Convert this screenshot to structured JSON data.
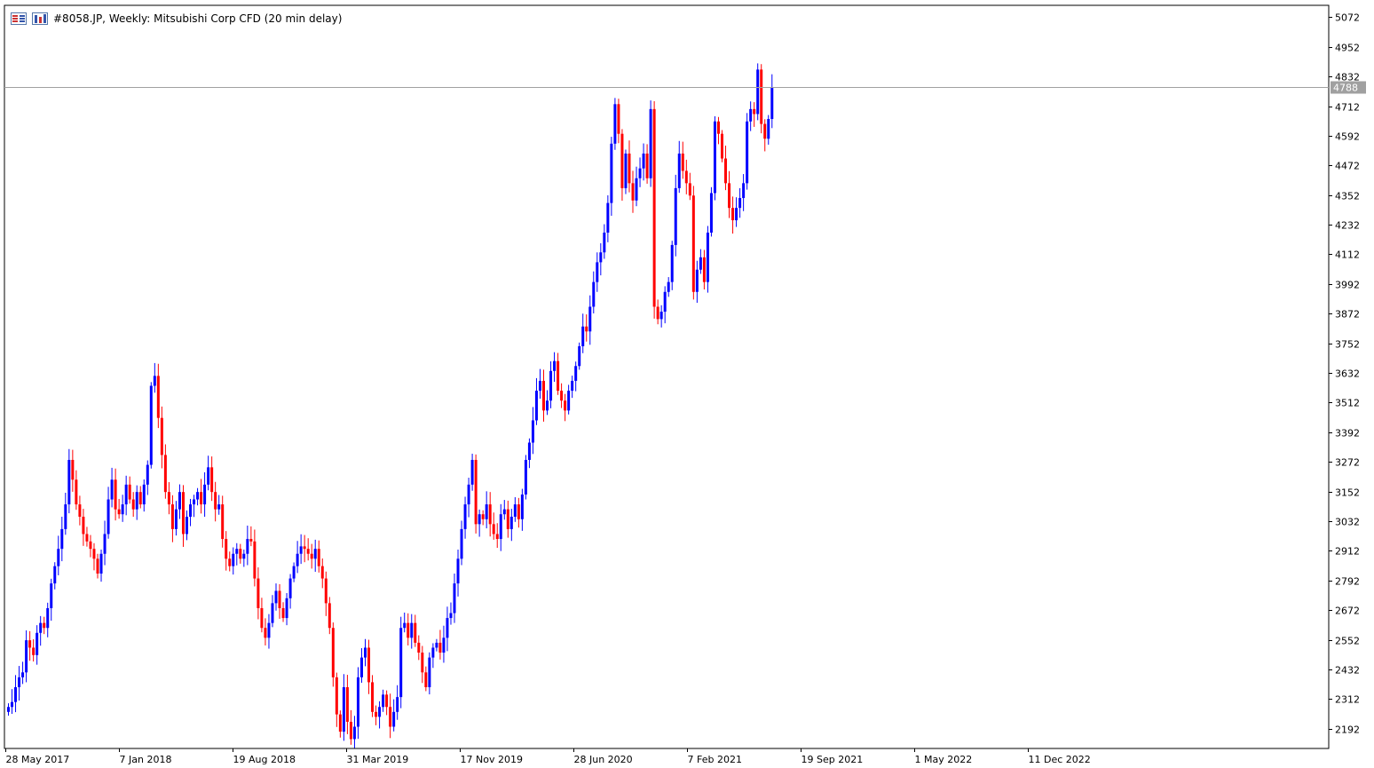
{
  "header": {
    "title": "#8058.JP, Weekly:  Mitsubishi Corp CFD (20 min delay)",
    "icons": [
      "list-icon",
      "depth-of-market-icon"
    ]
  },
  "colors": {
    "up": "#0000ff",
    "down": "#ff0000",
    "grid": "#d8d8d8",
    "axis": "#000000",
    "price_line": "#a0a0a0",
    "price_label_bg": "#a0a0a0"
  },
  "chart_data": {
    "type": "candlestick",
    "title": "#8058.JP, Weekly:  Mitsubishi Corp CFD (20 min delay)",
    "grid": false,
    "y_axis": {
      "ylim": [
        2112,
        5120
      ],
      "ticks": [
        "5072",
        "4952",
        "4832",
        "4712",
        "4592",
        "4472",
        "4352",
        "4232",
        "4112",
        "3992",
        "3872",
        "3752",
        "3632",
        "3512",
        "3392",
        "3272",
        "3152",
        "3032",
        "2912",
        "2792",
        "2672",
        "2552",
        "2432",
        "2312",
        "2192"
      ]
    },
    "x_axis": {
      "ticks": [
        "28 May 2017",
        "7 Jan 2018",
        "19 Aug 2018",
        "31 Mar 2019",
        "17 Nov 2019",
        "28 Jun 2020",
        "7 Feb 2021",
        "19 Sep 2021",
        "1 May 2022",
        "11 Dec 2022"
      ]
    },
    "current_price": "4788",
    "closes": [
      2280,
      2300,
      2360,
      2400,
      2420,
      2550,
      2520,
      2490,
      2580,
      2620,
      2600,
      2680,
      2780,
      2850,
      2920,
      3000,
      3100,
      3280,
      3200,
      3100,
      3050,
      2980,
      2950,
      2920,
      2880,
      2820,
      2900,
      2980,
      3120,
      3200,
      3080,
      3060,
      3100,
      3180,
      3120,
      3080,
      3150,
      3100,
      3180,
      3260,
      3580,
      3620,
      3450,
      3300,
      3150,
      3100,
      3000,
      3080,
      3150,
      2980,
      3050,
      3100,
      3120,
      3150,
      3100,
      3180,
      3250,
      3150,
      3080,
      3100,
      2960,
      2880,
      2850,
      2900,
      2920,
      2880,
      2900,
      2960,
      2950,
      2800,
      2680,
      2600,
      2560,
      2620,
      2700,
      2750,
      2680,
      2640,
      2720,
      2800,
      2850,
      2900,
      2930,
      2920,
      2900,
      2880,
      2920,
      2850,
      2800,
      2700,
      2600,
      2400,
      2250,
      2180,
      2360,
      2220,
      2150,
      2200,
      2400,
      2480,
      2520,
      2380,
      2260,
      2240,
      2280,
      2330,
      2280,
      2200,
      2260,
      2320,
      2600,
      2620,
      2560,
      2620,
      2540,
      2500,
      2420,
      2360,
      2480,
      2520,
      2540,
      2500,
      2560,
      2640,
      2660,
      2780,
      2880,
      3000,
      3100,
      3180,
      3280,
      3020,
      3060,
      3040,
      3100,
      3020,
      2980,
      2960,
      3060,
      3080,
      3000,
      3050,
      3100,
      3040,
      3140,
      3280,
      3350,
      3440,
      3560,
      3600,
      3480,
      3520,
      3640,
      3680,
      3560,
      3520,
      3480,
      3560,
      3600,
      3660,
      3740,
      3820,
      3800,
      3900,
      4000,
      4080,
      4120,
      4200,
      4320,
      4560,
      4720,
      4600,
      4380,
      4520,
      4400,
      4330,
      4420,
      4460,
      4520,
      4420,
      4700,
      3900,
      3850,
      3880,
      3960,
      4000,
      4150,
      4380,
      4520,
      4450,
      4400,
      4350,
      3960,
      4050,
      4100,
      4000,
      4200,
      4360,
      4650,
      4600,
      4500,
      4400,
      4300,
      4250,
      4300,
      4340,
      4400,
      4650,
      4700,
      4680,
      4860,
      4640,
      4580,
      4660,
      4788
    ]
  }
}
